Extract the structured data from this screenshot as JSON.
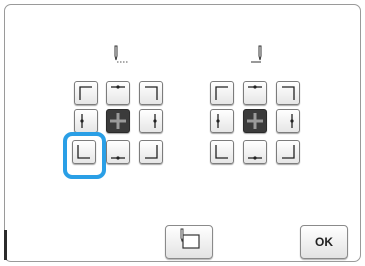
{
  "buttons": {
    "ok_label": "OK",
    "frame_icon": "frame-trial-icon"
  },
  "colors": {
    "selection": "#2a9fe6",
    "center": "#3b3b3b"
  },
  "left_grid": {
    "icon": "needle-dotted-icon",
    "selected": "bottom-left"
  },
  "right_grid": {
    "icon": "needle-solid-icon"
  }
}
